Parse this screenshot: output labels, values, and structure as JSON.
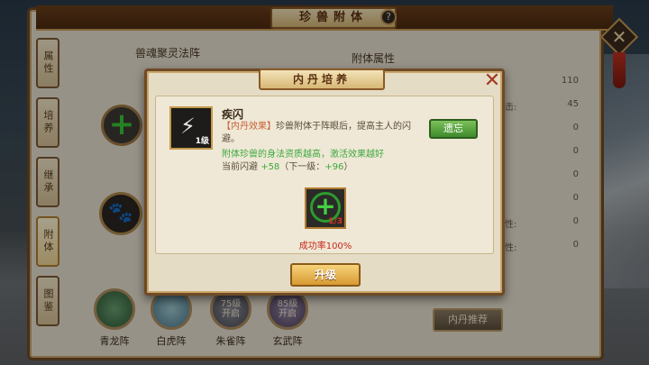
{
  "main": {
    "title": "珍兽附体",
    "help_icon": "?",
    "close_icon": "✕"
  },
  "side_tabs": [
    "属性",
    "培养",
    "继承",
    "附体",
    "图鉴"
  ],
  "left": {
    "section_title": "兽魂聚灵法阵",
    "formations": [
      {
        "label": "青龙阵",
        "lock_text": ""
      },
      {
        "label": "白虎阵",
        "lock_text": ""
      },
      {
        "label": "朱雀阵",
        "lock_text": "75级\n开启"
      },
      {
        "label": "玄武阵",
        "lock_text": "85级\n开启"
      }
    ]
  },
  "right": {
    "section_title": "附体属性",
    "attrs": [
      {
        "label": "",
        "value": "110"
      },
      {
        "label": "击:",
        "value": "45"
      },
      {
        "label": "",
        "value": "0"
      },
      {
        "label": "",
        "value": "0"
      },
      {
        "label": "",
        "value": "0"
      },
      {
        "label": "",
        "value": "0"
      },
      {
        "label": "性:",
        "value": "0"
      },
      {
        "label": "性:",
        "value": "0"
      }
    ],
    "recommend_button": "内丹推荐"
  },
  "dialog": {
    "title": "内丹培养",
    "close_icon": "✕",
    "skill": {
      "level": "1级",
      "name": "疾闪",
      "desc_bracket": "【内丹效果】",
      "desc_text": "珍兽附体于阵眼后，提高主人的闪避。",
      "note": "附体珍兽的身法资质越高，激活效果越好",
      "stat_prefix": "当前闪避",
      "stat_current": "+58",
      "stat_next_prefix": "（下一级：",
      "stat_next": "+96",
      "stat_next_suffix": "）"
    },
    "forget_button": "遗忘",
    "material_count": "1/3",
    "success_rate": "成功率100%",
    "upgrade_button": "升级"
  }
}
